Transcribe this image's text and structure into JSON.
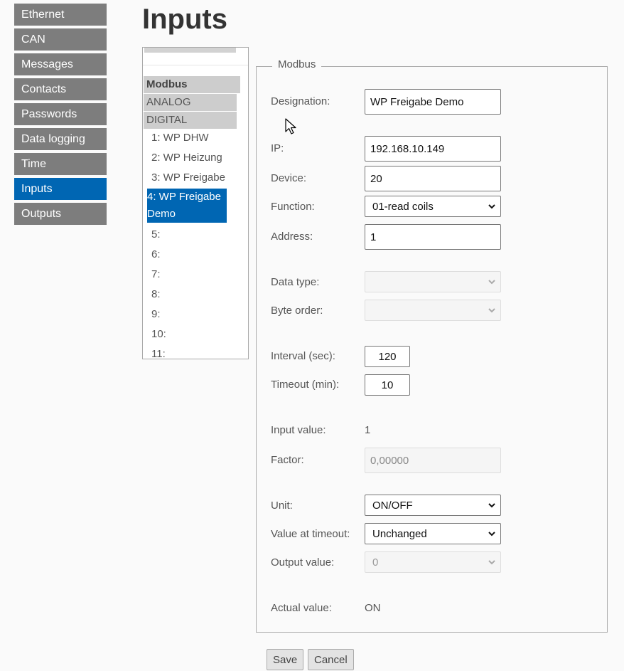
{
  "nav": {
    "items": [
      "Ethernet",
      "CAN",
      "Messages",
      "Contacts",
      "Passwords",
      "Data logging",
      "Time",
      "Inputs",
      "Outputs"
    ],
    "active": "Inputs"
  },
  "page": {
    "title": "Inputs"
  },
  "tree": {
    "categories": [
      "Modbus",
      "ANALOG",
      "DIGITAL"
    ],
    "items": [
      "1: WP DHW",
      "2: WP Heizung",
      "3: WP Freigabe",
      "4: WP Freigabe Demo",
      "5:",
      "6:",
      "7:",
      "8:",
      "9:",
      "10:",
      "11:"
    ],
    "selected_index": 3
  },
  "form": {
    "legend": "Modbus",
    "designation": {
      "label": "Designation:",
      "value": "WP Freigabe Demo"
    },
    "ip": {
      "label": "IP:",
      "value": "192.168.10.149"
    },
    "device": {
      "label": "Device:",
      "value": "20"
    },
    "function": {
      "label": "Function:",
      "value": "01-read coils"
    },
    "address": {
      "label": "Address:",
      "value": "1"
    },
    "data_type": {
      "label": "Data type:",
      "value": ""
    },
    "byte_order": {
      "label": "Byte order:",
      "value": ""
    },
    "interval": {
      "label": "Interval (sec):",
      "value": "120"
    },
    "timeout": {
      "label": "Timeout (min):",
      "value": "10"
    },
    "input_value": {
      "label": "Input value:",
      "value": "1"
    },
    "factor": {
      "label": "Factor:",
      "value": "0,00000"
    },
    "unit": {
      "label": "Unit:",
      "value": "ON/OFF"
    },
    "value_at_timeout": {
      "label": "Value at timeout:",
      "value": "Unchanged"
    },
    "output_value": {
      "label": "Output value:",
      "value": "0"
    },
    "actual_value": {
      "label": "Actual value:",
      "value": "ON"
    }
  },
  "buttons": {
    "save": "Save",
    "cancel": "Cancel"
  },
  "colors": {
    "accent": "#0066b3",
    "nav_bg": "#7d7d7d",
    "tree_cat_bg": "#cdcdcd"
  }
}
